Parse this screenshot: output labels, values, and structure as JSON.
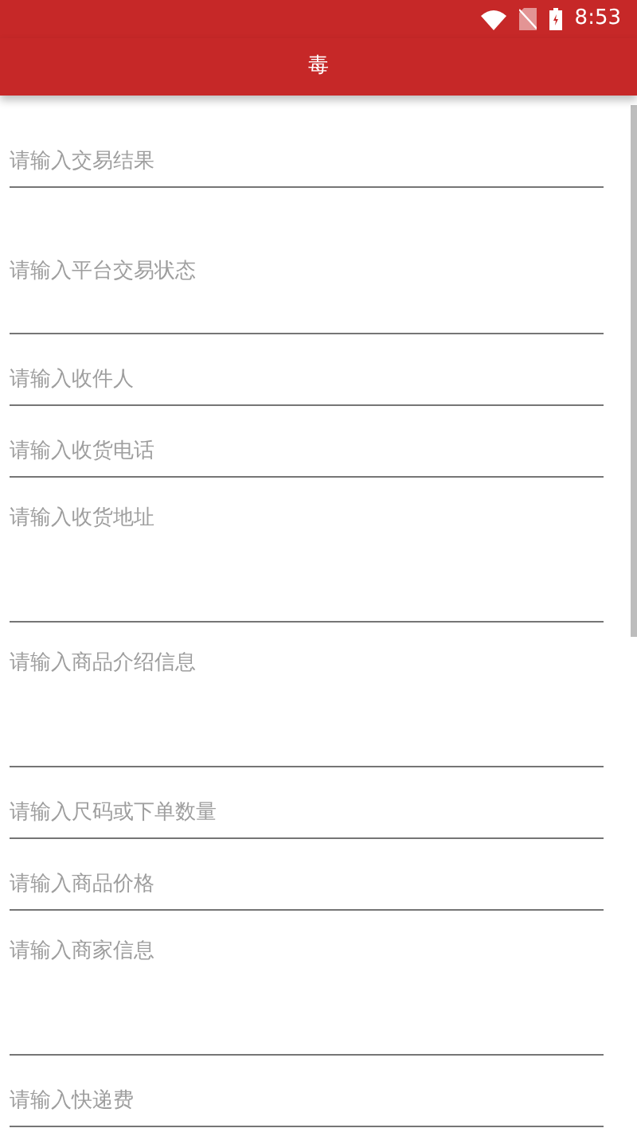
{
  "status_bar": {
    "time": "8:53"
  },
  "toolbar": {
    "title": "毒"
  },
  "fields": [
    {
      "kind": "single",
      "placeholder": "请输入交易结果"
    },
    {
      "kind": "centered",
      "placeholder": "请输入平台交易状态"
    },
    {
      "kind": "single",
      "placeholder": "请输入收件人"
    },
    {
      "kind": "single",
      "placeholder": "请输入收货电话"
    },
    {
      "kind": "multiline",
      "placeholder": "请输入收货地址"
    },
    {
      "kind": "multiline",
      "placeholder": "请输入商品介绍信息"
    },
    {
      "kind": "single",
      "placeholder": "请输入尺码或下单数量"
    },
    {
      "kind": "single",
      "placeholder": "请输入商品价格"
    },
    {
      "kind": "multiline",
      "placeholder": "请输入商家信息"
    },
    {
      "kind": "single",
      "placeholder": "请输入快递费"
    }
  ]
}
